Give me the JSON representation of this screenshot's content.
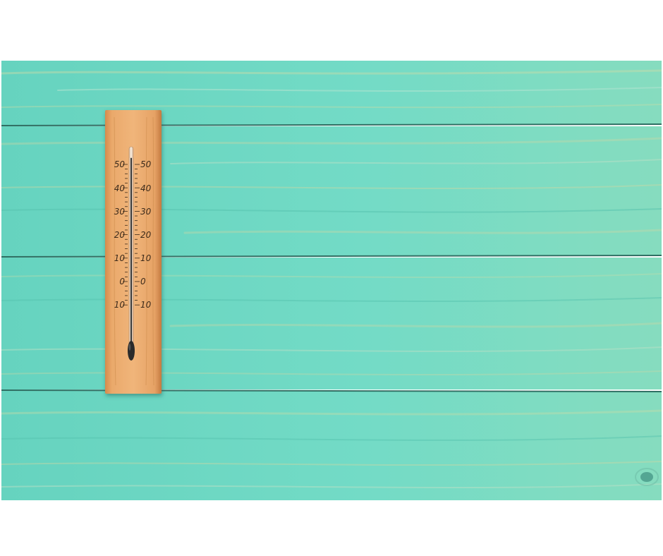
{
  "photo": {
    "subject": "wooden wall thermometer on turquoise painted wood planks",
    "colors": {
      "page_background": "#ffffff",
      "planks": "#6fd9c4",
      "plank_dark": "#4fbfaa",
      "grain_light": "#c7d8a6",
      "thermometer_wood": "#e8a868",
      "scale_text": "#3c2a1a"
    }
  },
  "thermometer": {
    "scale_labels": [
      "50",
      "40",
      "30",
      "20",
      "10",
      "0",
      "10"
    ],
    "reading_fraction": 0.95
  }
}
